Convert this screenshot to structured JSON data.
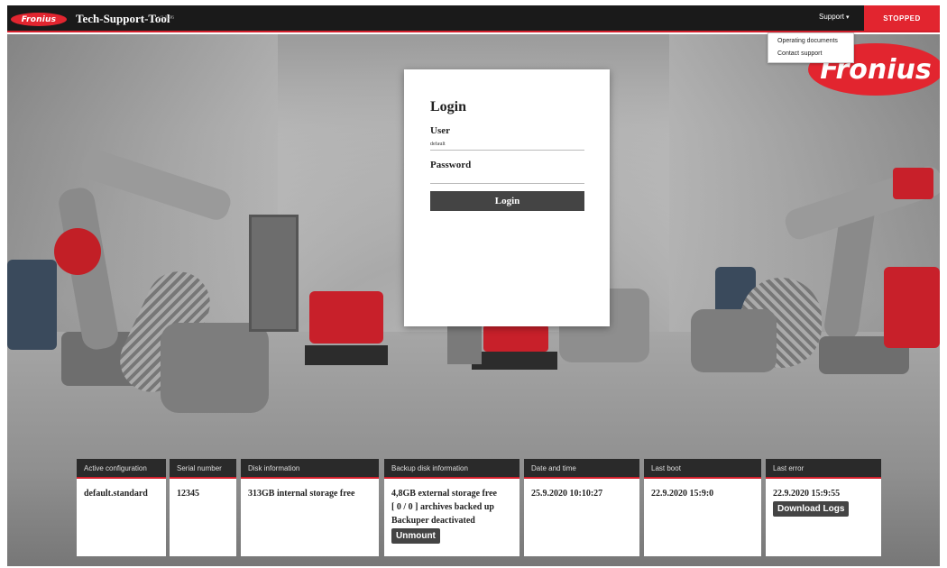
{
  "header": {
    "logo_text": "Fronius",
    "title": "Tech-Support-Tool",
    "version": "v3.1.96",
    "support_label": "Support",
    "status_label": "STOPPED"
  },
  "support_menu": {
    "items": [
      "Operating documents",
      "Contact support"
    ]
  },
  "background": {
    "brand_text": "Fronius"
  },
  "login": {
    "title": "Login",
    "user_label": "User",
    "user_value": "default",
    "password_label": "Password",
    "password_value": "",
    "button_label": "Login"
  },
  "panels": [
    {
      "title": "Active configuration",
      "lines": [
        "default.standard"
      ]
    },
    {
      "title": "Serial number",
      "lines": [
        "12345"
      ]
    },
    {
      "title": "Disk information",
      "lines": [
        "313GB internal storage free"
      ]
    },
    {
      "title": "Backup disk information",
      "lines": [
        "4,8GB external storage free",
        "[ 0 / 0 ] archives backed up",
        "Backuper deactivated"
      ],
      "button": "Unmount"
    },
    {
      "title": "Date and time",
      "lines": [
        "25.9.2020 10:10:27"
      ]
    },
    {
      "title": "Last boot",
      "lines": [
        "22.9.2020 15:9:0"
      ]
    },
    {
      "title": "Last error",
      "lines": [
        "22.9.2020 15:9:55"
      ],
      "button": "Download Logs"
    }
  ],
  "colors": {
    "brand_red": "#e2252f",
    "topbar": "#1a1a1a",
    "button_dark": "#444444"
  }
}
